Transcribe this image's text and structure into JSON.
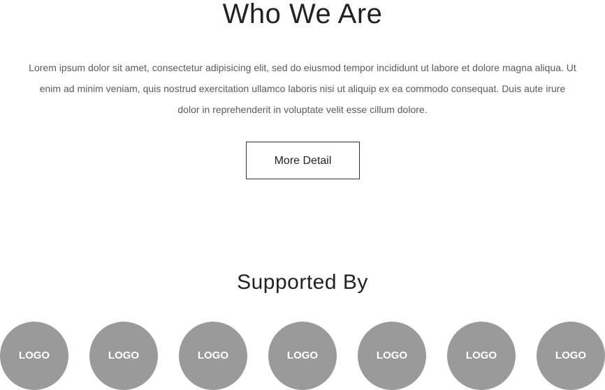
{
  "who": {
    "title": "Who We Are",
    "body": "Lorem ipsum dolor sit amet, consectetur adipisicing elit, sed do eiusmod tempor incididunt ut labore et dolore magna aliqua. Ut enim ad minim veniam, quis nostrud exercitation ullamco laboris nisi ut aliquip ex ea commodo consequat. Duis aute irure dolor in reprehenderit in voluptate velit esse cillum dolore.",
    "button_label": "More Detail"
  },
  "supported": {
    "title": "Supported By",
    "logos": [
      {
        "label": "LOGO"
      },
      {
        "label": "LOGO"
      },
      {
        "label": "LOGO"
      },
      {
        "label": "LOGO"
      },
      {
        "label": "LOGO"
      },
      {
        "label": "LOGO"
      },
      {
        "label": "LOGO"
      }
    ]
  },
  "colors": {
    "logo_fill": "#9a9a9a",
    "text": "#222222",
    "body_text": "#5a5a5a"
  }
}
